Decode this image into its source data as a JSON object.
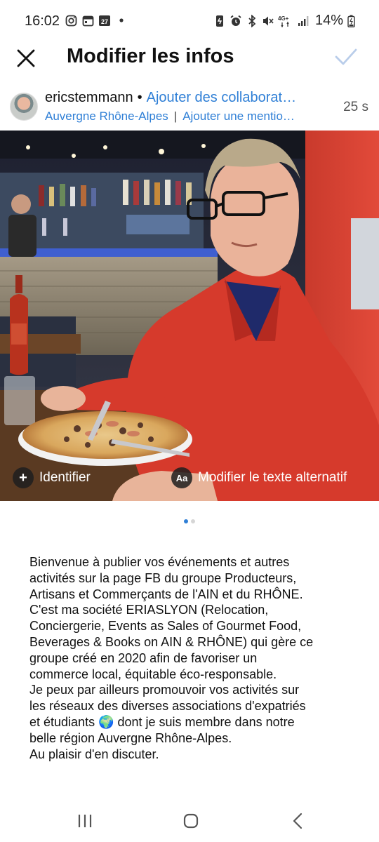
{
  "status_bar": {
    "time": "16:02",
    "battery": "14%",
    "calendar_day": "27",
    "network": "4G+"
  },
  "header": {
    "title": "Modifier les infos"
  },
  "author": {
    "username": "ericstemmann",
    "separator": "•",
    "add_collaborators": "Ajouter des collaborat…",
    "location": "Auvergne Rhône-Alpes",
    "pipe": "|",
    "add_mention": "Ajouter une mentio…",
    "time_ago": "25 s"
  },
  "photo": {
    "identify_label": "Identifier",
    "alt_text_label": "Modifier le texte alternatif",
    "alt_icon_text": "Aa"
  },
  "pager": {
    "count": 2,
    "active": 1
  },
  "caption": {
    "lines": [
      "Bienvenue à publier vos événements et autres",
      "activités sur la page FB du groupe Producteurs,",
      "Artisans et Commerçants de l'AIN et du RHÔNE.",
      "C'est ma société ERIASLYON (Relocation,",
      "Conciergerie, Events as Sales of Gourmet Food,",
      "Beverages & Books on AIN & RHÔNE) qui gère ce",
      "groupe créé en 2020 afin de favoriser un",
      "commerce local, équitable éco-responsable.",
      "Je peux par ailleurs promouvoir vos activités sur",
      "les réseaux des diverses associations d'expatriés",
      "et étudiants 🌍 dont je suis membre dans notre",
      "belle région Auvergne Rhône-Alpes.",
      "Au plaisir d'en discuter."
    ]
  },
  "colors": {
    "accent_blue": "#2f7fd6",
    "confirm_disabled": "#b9cdea",
    "sweater_red": "#d63a2c"
  },
  "icons": {
    "close": "close-icon",
    "confirm": "check-icon",
    "identify": "plus-icon",
    "alt_text": "alt-text-icon",
    "nav_recents": "recent-apps-icon",
    "nav_home": "home-icon",
    "nav_back": "back-icon"
  }
}
